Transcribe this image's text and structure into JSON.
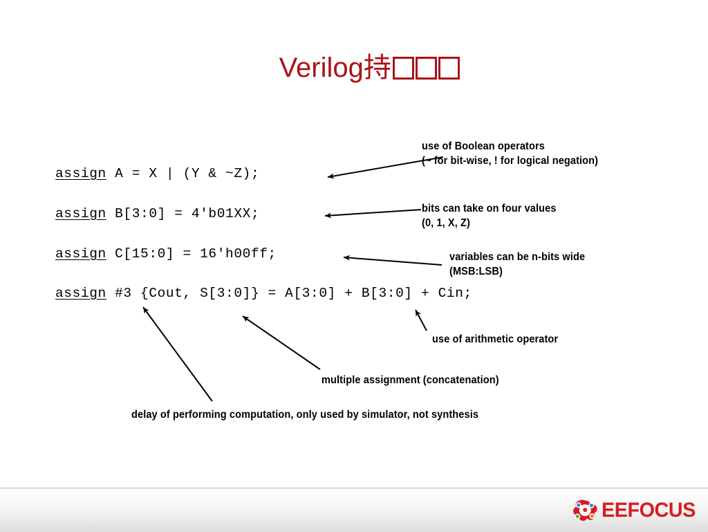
{
  "slide": {
    "title_text": "Verilog持",
    "title_tofu_count": 3,
    "title_color": "#AA1317",
    "background": "#ffffff"
  },
  "code": {
    "keyword": "assign",
    "lines": [
      {
        "keyword": "assign",
        "rest": " A = X | (Y & ~Z);"
      },
      {
        "keyword": "assign",
        "rest": " B[3:0] = 4'b01XX;"
      },
      {
        "keyword": "assign",
        "rest": " C[15:0] = 16'h00ff;"
      },
      {
        "keyword": "assign",
        "rest": " #3 {Cout, S[3:0]} = A[3:0] + B[3:0] + Cin;"
      }
    ]
  },
  "annotations": {
    "boolean": "use of Boolean operators\n(~ for bit-wise, ! for logical negation)",
    "four_values": "bits can take on four values\n(0, 1, X, Z)",
    "n_bits": "variables can be n-bits wide\n(MSB:LSB)",
    "arithmetic": "use of arithmetic operator",
    "multiple_assignment": "multiple assignment (concatenation)",
    "delay": "delay of performing computation, only used by simulator, not synthesis"
  },
  "footer": {
    "logo_text": "EEFOCUS",
    "logo_color": "#D81B22",
    "logo_icon": "atom-molecule-icon",
    "dot_colors": [
      "#2E8BD8",
      "#E2231A",
      "#5FB52C",
      "#F08A16",
      "#ffffff"
    ]
  }
}
